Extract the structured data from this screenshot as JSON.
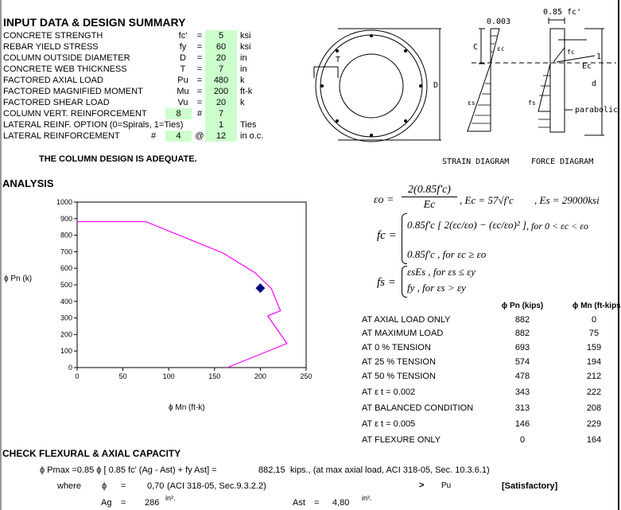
{
  "summary": {
    "title": "INPUT DATA & DESIGN SUMMARY",
    "rows": [
      {
        "label": "CONCRETE STRENGTH",
        "symbol": "fc'",
        "eq": "=",
        "value": "5",
        "unit": "ksi"
      },
      {
        "label": "REBAR YIELD STRESS",
        "symbol": "fy",
        "eq": "=",
        "value": "60",
        "unit": "ksi"
      },
      {
        "label": "COLUMN OUTSIDE DIAMETER",
        "symbol": "D",
        "eq": "=",
        "value": "20",
        "unit": "in"
      },
      {
        "label": "CONCRETE WEB THICKNESS",
        "symbol": "T",
        "eq": "=",
        "value": "7",
        "unit": "in"
      },
      {
        "label": "FACTORED AXIAL LOAD",
        "symbol": "Pu",
        "eq": "=",
        "value": "480",
        "unit": "k"
      },
      {
        "label": "FACTORED MAGNIFIED MOMENT",
        "symbol": "Mu",
        "eq": "=",
        "value": "200",
        "unit": "ft-k"
      },
      {
        "label": "FACTORED SHEAR LOAD",
        "symbol": "Vu",
        "eq": "=",
        "value": "20",
        "unit": "k"
      }
    ],
    "vert_reinf": {
      "label": "COLUMN VERT. REINFORCEMENT",
      "count": "8",
      "hash": "#",
      "size": "7"
    },
    "lat_option": {
      "label": "LATERAL REINF. OPTION (0=Spirals, 1=Ties)",
      "value": "1",
      "unit": "Ties"
    },
    "lat_reinf": {
      "label": "LATERAL REINFORCEMENT",
      "hash": "#",
      "size": "4",
      "at": "@",
      "spacing": "12",
      "unit": "in o.c."
    },
    "verdict": "THE COLUMN DESIGN IS ADEQUATE.",
    "input_cell_color": "#ccffcc"
  },
  "diagram": {
    "strain_top": "0.003",
    "force_top": "0.85  fc'",
    "c_label": "C",
    "d_label": "D",
    "t_label": "T",
    "eps_c": "εc",
    "eps_s": "εs",
    "fc": "fc",
    "fs": "fs",
    "ec": "Ec",
    "one": "1",
    "dd": "d",
    "parabolic": "parabolic",
    "strain_caption": "STRAIN  DIAGRAM",
    "force_caption": "FORCE  DIAGRAM"
  },
  "analysis": {
    "title": "ANALYSIS"
  },
  "formulas": {
    "eps0_lhs": "εo =",
    "eps0_num": "2(0.85f'c)",
    "eps0_den": "Ec",
    "ec_eq": ",  Ec = 57√f'c",
    "es_eq": ",  Es = 29000ksi",
    "fc_lhs": "fc =",
    "fc_case1": "0.85f'c [ 2(εc/εo) − (εc/εo)² ]",
    "fc_cond1": ",  for  0 < εc < εo",
    "fc_case2": "0.85f'c  ,  for  εc ≥ εo",
    "fs_lhs": "fs =",
    "fs_case1": "εsEs  ,  for  εs ≤ εy",
    "fs_case2": "fy  ,  for  εs > εy"
  },
  "table": {
    "headers": [
      "",
      "ϕ Pn (kips)",
      "ϕ Mn (ft-kips)"
    ],
    "rows": [
      [
        "AT AXIAL LOAD ONLY",
        "882",
        "0"
      ],
      [
        "AT MAXIMUM LOAD",
        "882",
        "75"
      ],
      [
        "AT 0 % TENSION",
        "693",
        "159"
      ],
      [
        "AT 25 % TENSION",
        "574",
        "194"
      ],
      [
        "AT 50 % TENSION",
        "478",
        "212"
      ],
      [
        "AT ε t = 0.002",
        "343",
        "222"
      ],
      [
        "AT BALANCED CONDITION",
        "313",
        "208"
      ],
      [
        "AT ε t = 0.005",
        "146",
        "229"
      ],
      [
        "AT FLEXURE ONLY",
        "0",
        "164"
      ]
    ]
  },
  "chart_data": {
    "type": "line",
    "xlabel": "ϕ Mn (ft-k)",
    "ylabel": "ϕ Pn (k)",
    "xlim": [
      0,
      250
    ],
    "ylim": [
      0,
      1000
    ],
    "xticks": [
      "0",
      "50",
      "100",
      "150",
      "200",
      "250"
    ],
    "yticks": [
      "0",
      "100",
      "200",
      "300",
      "400",
      "500",
      "600",
      "700",
      "800",
      "900",
      "1000"
    ],
    "grid": false,
    "series": [
      {
        "type": "line",
        "color": "#ff00ff",
        "x": [
          0,
          75,
          159,
          194,
          212,
          222,
          208,
          229,
          164
        ],
        "y": [
          882,
          882,
          693,
          574,
          478,
          343,
          313,
          146,
          0
        ]
      },
      {
        "type": "scatter",
        "marker": "diamond",
        "color": "#000080",
        "x": [
          200
        ],
        "y": [
          480
        ]
      }
    ]
  },
  "check": {
    "title": "CHECK FLEXURAL & AXIAL CAPACITY",
    "pmax_formula": "ϕ Pmax =0.85  ϕ [ 0.85 fc' (Ag - Ast) + fy Ast]   =",
    "pmax_value": "882,15",
    "pmax_note": "kips., (at max axial load, ACI 318-05, Sec. 10.3.6.1)",
    "where": "where",
    "phi": "ϕ",
    "eq": "=",
    "phi_value": "0,70",
    "phi_note": "(ACI 318-05, Sec.9.3.2.2)",
    "gt": ">",
    "pu": "Pu",
    "status": "[Satisfactory]",
    "ag_label": "Ag",
    "ag_value": "286",
    "ag_unit": "in².",
    "ast_label": "Ast",
    "ast_value": "4,80",
    "ast_unit": "in²."
  }
}
